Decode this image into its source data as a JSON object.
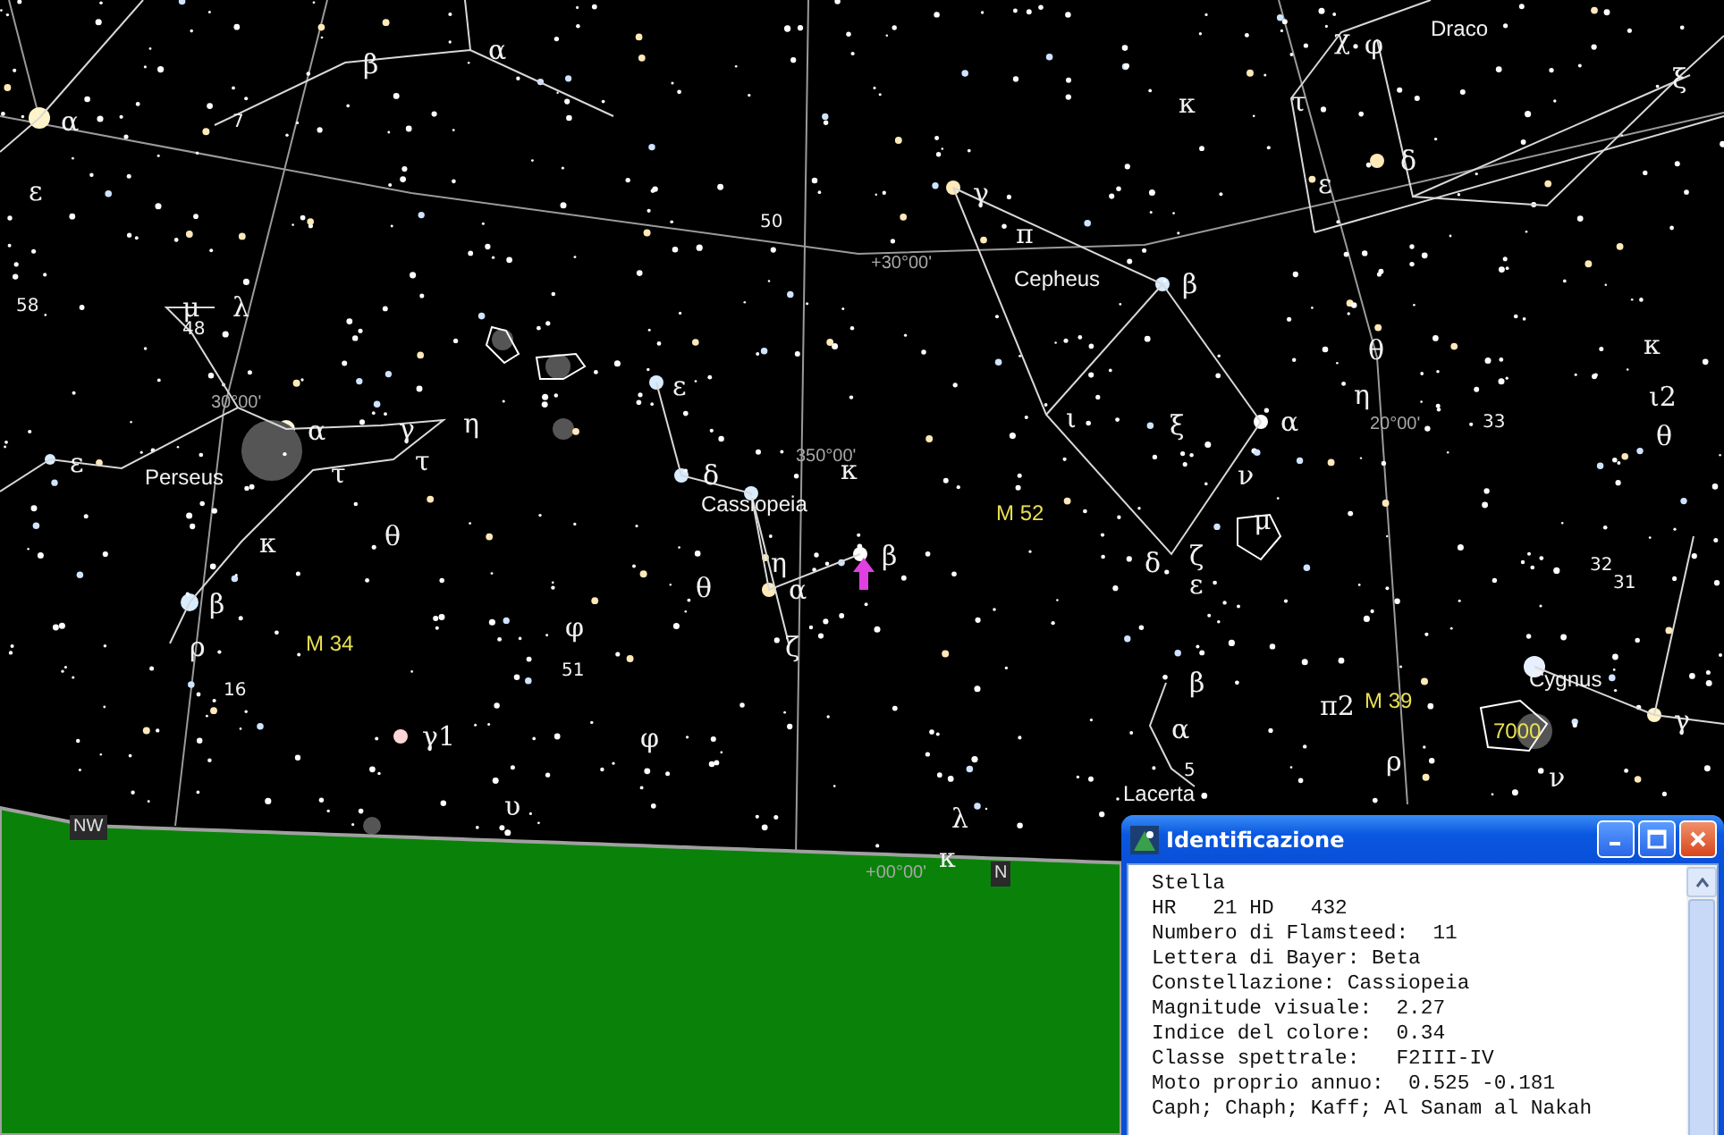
{
  "sky_chart": {
    "star_labels": [
      "α",
      "β",
      "α",
      "ε",
      "μ",
      "λ",
      "ε",
      "χ",
      "φ",
      "κ",
      "τ",
      "ξ",
      "δ",
      "ε",
      "γ",
      "π",
      "β",
      "θ",
      "κ",
      "η",
      "ι2",
      "ε",
      "α",
      "γ",
      "η",
      "τ",
      "τ",
      "κ",
      "θ",
      "β",
      "ρ",
      "φ",
      "γ1",
      "φ",
      "υ",
      "δ",
      "κ",
      "η",
      "θ",
      "α",
      "ζ",
      "β",
      "ι",
      "ξ",
      "α",
      "ν",
      "θ",
      "μ",
      "δ",
      "ζ",
      "ε",
      "β",
      "α",
      "π2",
      "ρ",
      "ν",
      "λ",
      "κ",
      "γ"
    ],
    "star_numbers": [
      "7",
      "50",
      "58",
      "48",
      "16",
      "51",
      "33",
      "32",
      "31",
      "5"
    ],
    "constellations": [
      "Draco",
      "Cepheus",
      "Perseus",
      "Cassiopeia",
      "Lacerta",
      "Cygnus"
    ],
    "deep_sky_labels": [
      "M 52",
      "M 34",
      "M 39",
      "7000"
    ],
    "grid_labels": [
      "+30°00'",
      "350°00'",
      "20°00'",
      "+00°00'",
      "30°00'"
    ],
    "compass_points": [
      "NW",
      "N"
    ]
  },
  "identification_window": {
    "title": "Identificazione",
    "lines": [
      "Stella",
      "HR   21 HD   432",
      "Numbero di Flamsteed:  11",
      "Lettera di Bayer: Beta",
      "Constellazione: Cassiopeia",
      "Magnitude visuale:  2.27",
      "Indice del colore:  0.34",
      "Classe spettrale:   F2III-IV",
      "Moto proprio annuo:  0.525 -0.181",
      "Caph; Chaph; Kaff; Al Sanam al Nakah"
    ]
  }
}
